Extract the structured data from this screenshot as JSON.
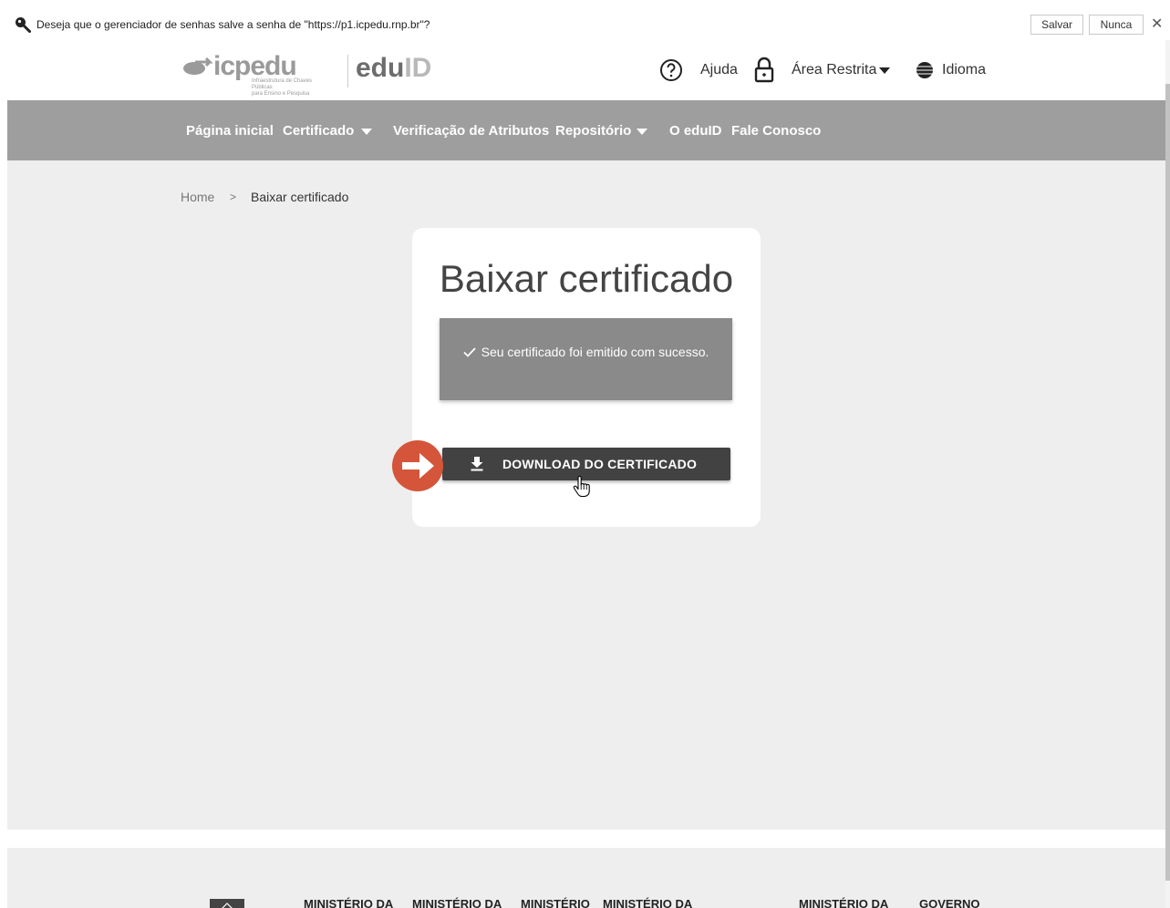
{
  "password_prompt": {
    "message": "Deseja que o gerenciador de senhas salve a senha de \"https://p1.icpedu.rnp.br\"?",
    "save_label": "Salvar",
    "never_label": "Nunca",
    "close_label": "✕"
  },
  "header": {
    "logo_icpedu": "icpedu",
    "logo_tagline_1": "Infraestrutura de Chaves Públicas",
    "logo_tagline_2": "para Ensino e Pesquisa",
    "logo_edu": "edu",
    "logo_id": "ID",
    "help_label": "Ajuda",
    "area_label": "Área Restrita",
    "language_label": "Idioma"
  },
  "nav": {
    "home": "Página inicial",
    "certificate": "Certificado",
    "attribute_check": "Verificação de Atributos",
    "repository": "Repositório",
    "about": "O eduID",
    "contact": "Fale Conosco"
  },
  "breadcrumb": {
    "home": "Home",
    "separator": ">",
    "current": "Baixar certificado"
  },
  "card": {
    "title": "Baixar certificado",
    "success_message": "Seu certificado foi emitido com sucesso.",
    "download_label": "DOWNLOAD DO CERTIFICADO"
  },
  "footer": {
    "ministry_1": "MINISTÉRIO DA",
    "ministry_2": "MINISTÉRIO DA",
    "ministry_3": "MINISTÉRIO",
    "ministry_4": "MINISTÉRIO DA",
    "ministry_5": "MINISTÉRIO DA",
    "government": "GOVERNO"
  },
  "colors": {
    "nav_bar": "#9e9e9e",
    "page_background": "#eeeeee",
    "alert_background": "#8a8a8a",
    "button_background": "#424242",
    "arrow_badge": "#d4553a"
  }
}
